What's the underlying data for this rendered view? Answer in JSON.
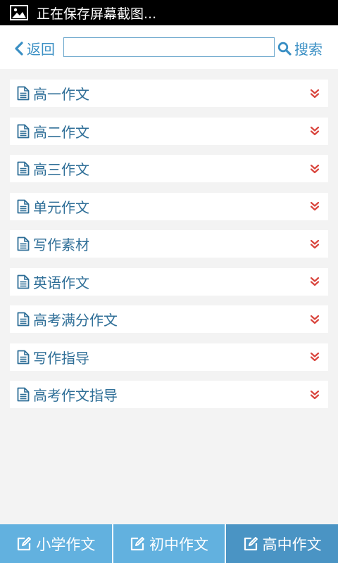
{
  "status_bar": {
    "icon": "image-icon",
    "text": "正在保存屏幕截图..."
  },
  "header": {
    "back_label": "返回",
    "search_value": "",
    "search_placeholder": "",
    "search_label": "搜索"
  },
  "list": {
    "items": [
      {
        "label": "高一作文",
        "icon": "document-icon",
        "action_icon": "chevron-double-down-icon"
      },
      {
        "label": "高二作文",
        "icon": "document-icon",
        "action_icon": "chevron-double-down-icon"
      },
      {
        "label": "高三作文",
        "icon": "document-icon",
        "action_icon": "chevron-double-down-icon"
      },
      {
        "label": "单元作文",
        "icon": "document-icon",
        "action_icon": "chevron-double-down-icon"
      },
      {
        "label": "写作素材",
        "icon": "document-icon",
        "action_icon": "chevron-double-down-icon"
      },
      {
        "label": "英语作文",
        "icon": "document-icon",
        "action_icon": "chevron-double-down-icon"
      },
      {
        "label": "高考满分作文",
        "icon": "document-icon",
        "action_icon": "chevron-double-down-icon"
      },
      {
        "label": "写作指导",
        "icon": "document-icon",
        "action_icon": "chevron-double-down-icon"
      },
      {
        "label": "高考作文指导",
        "icon": "document-icon",
        "action_icon": "chevron-double-down-icon"
      }
    ]
  },
  "tabbar": {
    "tabs": [
      {
        "label": "小学作文",
        "icon": "edit-icon",
        "active": false
      },
      {
        "label": "初中作文",
        "icon": "edit-icon",
        "active": false
      },
      {
        "label": "高中作文",
        "icon": "edit-icon",
        "active": true
      }
    ]
  },
  "colors": {
    "accent": "#3a8fc4",
    "item_text": "#2e6e97",
    "chevron": "#d9443c",
    "tab_bg": "#62b1df",
    "tab_active_bg": "#4a94c4",
    "page_bg": "#f3f3f3"
  }
}
